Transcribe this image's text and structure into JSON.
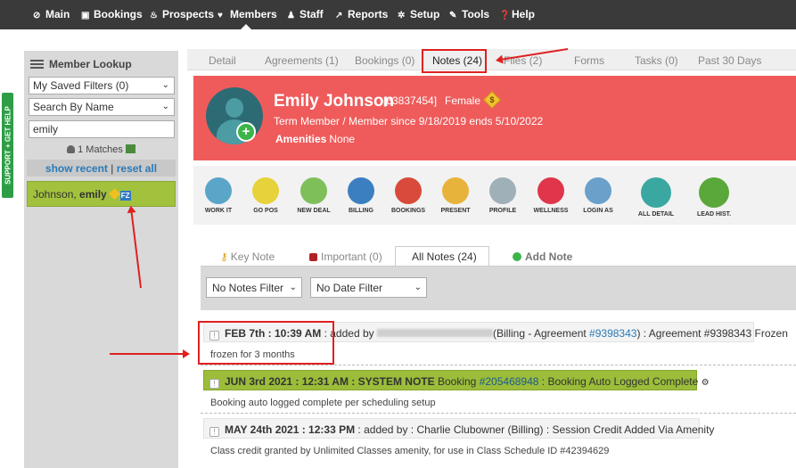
{
  "topnav": {
    "items": [
      {
        "label": "Main",
        "icon": "dashboard-icon"
      },
      {
        "label": "Bookings",
        "icon": "calendar-icon"
      },
      {
        "label": "Prospects",
        "icon": "flame-icon"
      },
      {
        "label": "Members",
        "icon": "heart-icon"
      },
      {
        "label": "Staff",
        "icon": "person-icon"
      },
      {
        "label": "Reports",
        "icon": "chart-icon"
      },
      {
        "label": "Setup",
        "icon": "gear-icon"
      },
      {
        "label": "Tools",
        "icon": "wrench-icon"
      },
      {
        "label": "Help",
        "icon": "help-icon"
      }
    ]
  },
  "support": {
    "label": "SUPPORT + GET HELP"
  },
  "sidebar": {
    "title": "Member Lookup",
    "saved_filters": "My Saved Filters (0)",
    "search_by": "Search By Name",
    "search_value": "emily",
    "matches": "1 Matches",
    "show_recent": "show recent",
    "separator": "|",
    "reset_all": "reset all",
    "member_last": "Johnson,",
    "member_first": "emily",
    "member_badge": "FZ"
  },
  "tabs": [
    {
      "label": "Detail"
    },
    {
      "label": "Agreements (1)"
    },
    {
      "label": "Bookings (0)"
    },
    {
      "label": "Notes (24)"
    },
    {
      "label": "Files (2)"
    },
    {
      "label": "Forms"
    },
    {
      "label": "Tasks (0)"
    },
    {
      "label": "Past 30 Days"
    }
  ],
  "profile": {
    "name": "Emily Johnson",
    "id": "[63837454]",
    "gender": "Female",
    "dollar_symbol": "$",
    "status": "Term Member / Member since 9/18/2019 ends 5/10/2022",
    "amenities_label": "Amenities",
    "amenities_value": "None",
    "add_symbol": "+"
  },
  "actions": [
    {
      "label": "WORK IT",
      "color": "#5aa6c8"
    },
    {
      "label": "GO POS",
      "color": "#e6d23a"
    },
    {
      "label": "NEW DEAL",
      "color": "#7fbf5a"
    },
    {
      "label": "BILLING",
      "color": "#3c7fc1"
    },
    {
      "label": "BOOKINGS",
      "color": "#d94a3a"
    },
    {
      "label": "PRESENT",
      "color": "#e8b33a"
    },
    {
      "label": "PROFILE",
      "color": "#9fb0b8"
    },
    {
      "label": "WELLNESS",
      "color": "#e0354a"
    },
    {
      "label": "LOGIN AS",
      "color": "#6aa0c9"
    },
    {
      "label": "ALL DETAIL",
      "color": "#3aa8a0"
    },
    {
      "label": "LEAD HIST.",
      "color": "#5aa83a"
    }
  ],
  "subtabs": {
    "key_note": "Key Note",
    "important": "Important (0)",
    "all_notes": "All Notes (24)",
    "add_note": "Add Note"
  },
  "filters": {
    "notes_filter": "No Notes Filter",
    "date_filter": "No Date Filter"
  },
  "notes": [
    {
      "date": "FEB 7th : 10:39 AM",
      "prefix": ": added by",
      "context": "(Billing - Agreement",
      "link": "#9398343",
      "suffix": ") : Agreement #9398343 Frozen",
      "body": "frozen for 3 months"
    },
    {
      "date": "JUN 3rd 2021 : 12:31 AM",
      "prefix": ": SYSTEM NOTE",
      "context": "Booking",
      "link": "#205468948",
      "suffix": ": Booking Auto Logged Complete",
      "body": "Booking auto logged complete per scheduling setup"
    },
    {
      "date": "MAY 24th 2021 : 12:33 PM",
      "prefix": ": added by : Charlie Clubowner (Billing) : Session Credit Added Via Amenity",
      "body": "Class credit granted by Unlimited Classes amenity, for use in Class Schedule ID #42394629"
    }
  ],
  "colors": {
    "nav_bg": "#3a3a3a",
    "profile_bg": "#ef5b5b",
    "member_bg": "#a2c23e",
    "annotation": "#e02020",
    "link": "#2a7ab8"
  }
}
